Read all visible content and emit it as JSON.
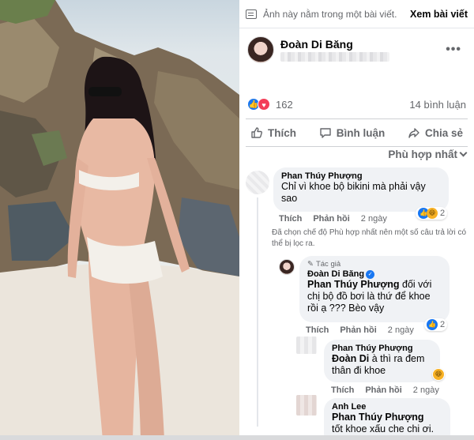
{
  "notice": {
    "text": "Ảnh này nằm trong một bài viết.",
    "link": "Xem bài viết"
  },
  "post": {
    "author": "Đoàn Di Băng",
    "reaction_count": "162",
    "comments_count": "14 bình luận",
    "actions": {
      "like": "Thích",
      "comment": "Bình luận",
      "share": "Chia sẻ"
    },
    "sort": "Phù hợp nhất"
  },
  "comments": [
    {
      "name": "Phan Thúy Phượng",
      "text": "Chỉ vì khoe bộ bikini mà phải vậy sao",
      "like": "Thích",
      "reply": "Phản hồi",
      "time": "2 ngày",
      "reactions": "2"
    }
  ],
  "filter_note": "Đã chọn chế độ Phù hợp nhất nên một số câu trả lời có thể bị lọc ra.",
  "replies": [
    {
      "author_tag": "Tác giả",
      "name": "Đoàn Di Băng",
      "mention": "Phan Thúy Phượng",
      "text": " đối với chị bộ đồ bơi là thứ để khoe rồi ạ ??? Bèo vậy",
      "like": "Thích",
      "reply": "Phản hồi",
      "time": "2 ngày",
      "reactions": "2"
    },
    {
      "name": "Phan Thúy Phượng",
      "mention": "Đoàn Di",
      "text": " à thì ra đem thân đi khoe",
      "like": "Thích",
      "reply": "Phản hồi",
      "time": "2 ngày"
    },
    {
      "name": "Anh Lee",
      "mention": "Phan Thúy Phượng",
      "text": "tốt khoe xấu che chi ơi."
    }
  ],
  "colors": {
    "accent": "#1877f2",
    "love": "#f33e58",
    "haha": "#f7b125",
    "bubble": "#f0f2f5",
    "muted": "#65676b"
  }
}
